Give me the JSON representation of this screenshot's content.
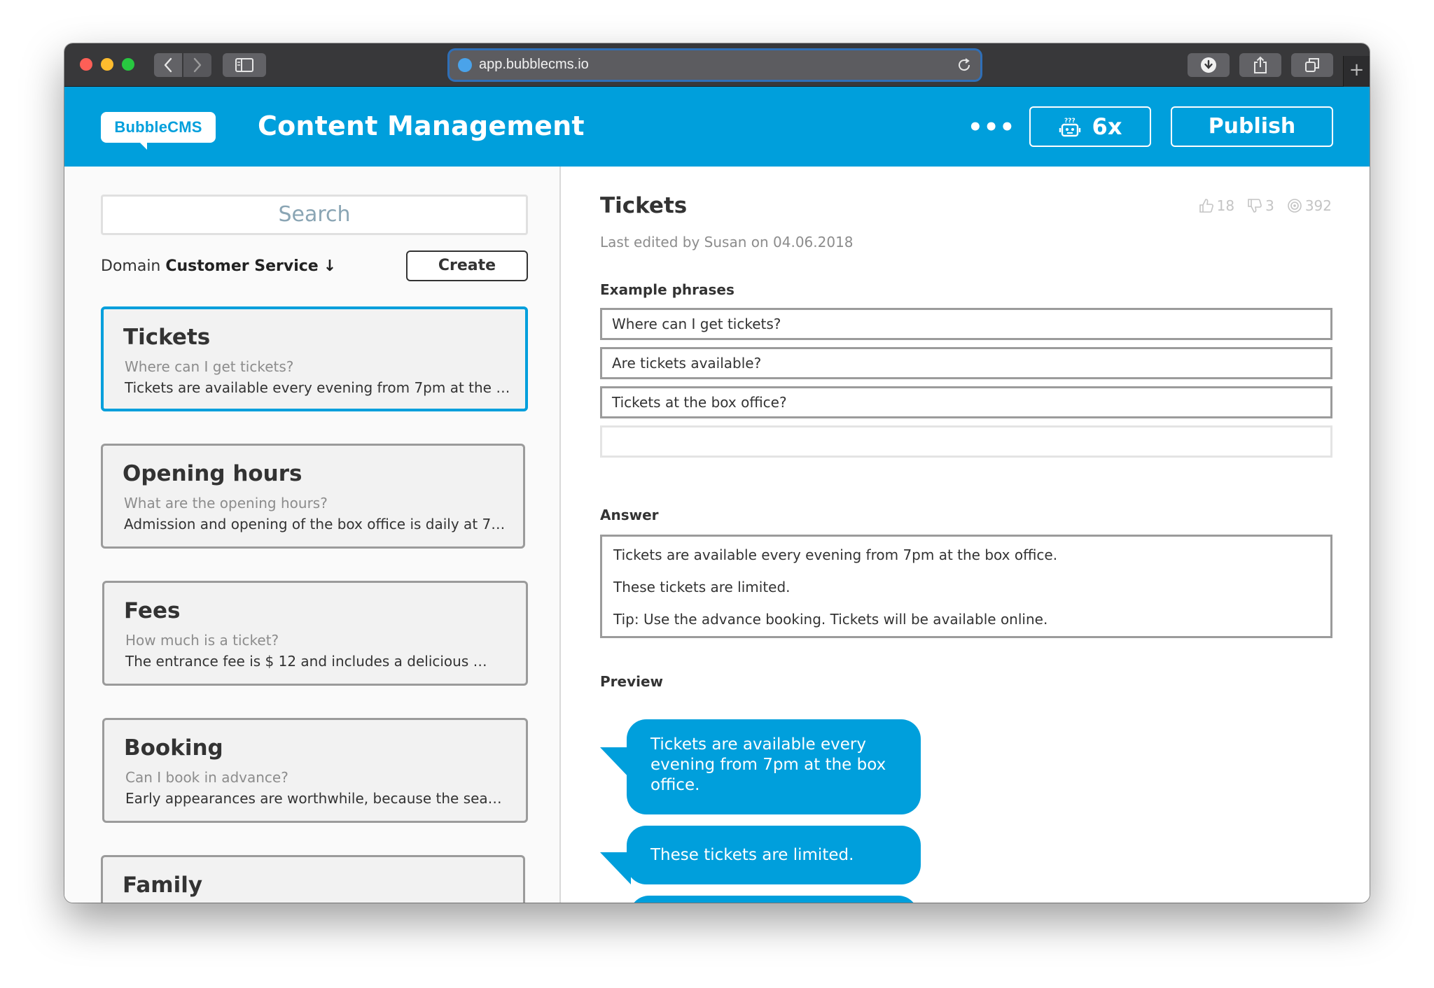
{
  "browser": {
    "url": "app.bubblecms.io",
    "new_tab_label": "+"
  },
  "header": {
    "logo_text": "BubbleCMS",
    "title": "Content Management",
    "more_label": "•••",
    "bot_count": "6x",
    "publish_label": "Publish"
  },
  "sidebar": {
    "search_placeholder": "Search",
    "domain_prefix": "Domain",
    "domain_name": "Customer Service",
    "domain_arrow": "↓",
    "create_label": "Create",
    "cards": [
      {
        "title": "Tickets",
        "question": "Where can I get tickets?",
        "answer": "Tickets are available every evening from 7pm at the …"
      },
      {
        "title": "Opening hours",
        "question": "What are the opening hours?",
        "answer": "Admission and opening of the box office is daily at 7…"
      },
      {
        "title": "Fees",
        "question": "How much is a ticket?",
        "answer": "The entrance fee is $ 12 and includes a delicious …"
      },
      {
        "title": "Booking",
        "question": "Can I book in advance?",
        "answer": "Early appearances are worthwhile, because the sea…"
      },
      {
        "title": "Family",
        "question": "",
        "answer": ""
      }
    ]
  },
  "detail": {
    "title": "Tickets",
    "likes": "18",
    "dislikes": "3",
    "views": "392",
    "meta": "Last edited by Susan on 04.06.2018",
    "phrases_label": "Example phrases",
    "phrases": [
      "Where can I get tickets?",
      "Are tickets available?",
      "Tickets at the box office?",
      ""
    ],
    "answer_label": "Answer",
    "answer_lines": [
      "Tickets are available every evening from 7pm at the box office.",
      "These tickets are limited.",
      "Tip: Use the advance booking. Tickets will be available online."
    ],
    "preview_label": "Preview",
    "preview_bubbles": [
      "Tickets are available every evening from 7pm at the box office.",
      "These tickets are limited."
    ]
  },
  "colors": {
    "brand": "#009fdc",
    "border": "#9b9b9b",
    "muted_text": "#8c8c8c"
  },
  "icons": [
    "back-icon",
    "forward-icon",
    "sidebar-icon",
    "globe-icon",
    "reload-icon",
    "download-icon",
    "share-icon",
    "tabs-icon",
    "bot-icon",
    "thumbs-up-icon",
    "thumbs-down-icon",
    "views-icon"
  ]
}
